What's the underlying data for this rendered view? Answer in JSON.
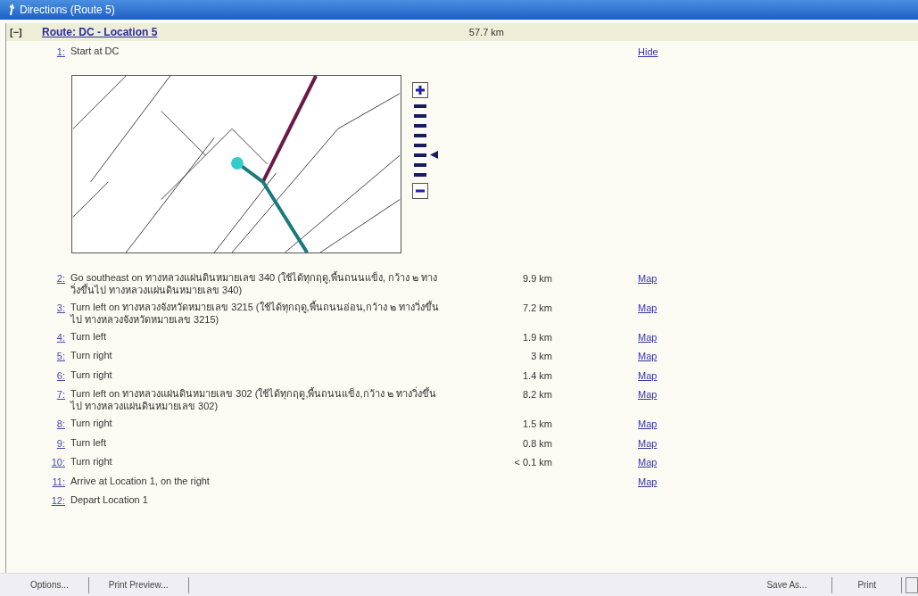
{
  "window": {
    "title": "Directions (Route 5)"
  },
  "route": {
    "toggle": "[−]",
    "expanded": true,
    "title": "Route: DC - Location 5",
    "distance": "57.7 km"
  },
  "steps": [
    {
      "number": "1:",
      "text": "Start at DC",
      "link": "Hide",
      "kind": "map",
      "zoom": {
        "level": 0.35
      }
    },
    {
      "number": "2:",
      "text": "Go southeast on ทางหลวงแผ่นดินหมายเลข 340 (ใช้ได้ทุกฤดู,พื้นถนนแข็ง, กว้าง ๒ ทางวิ่งขึ้นไป ทางหลวงแผ่นดินหมายเลข 340)",
      "distance": "9.9 km",
      "link": "Map",
      "kind": "step"
    },
    {
      "number": "3:",
      "text": "Turn left on ทางหลวงจังหวัดหมายเลข 3215 (ใช้ได้ทุกฤดู,พื้นถนนอ่อน,กว้าง ๒ ทางวิ่งขึ้นไป ทางหลวงจังหวัดหมายเลข 3215)",
      "distance": "7.2 km",
      "link": "Map",
      "kind": "step"
    },
    {
      "number": "4:",
      "text": "Turn left",
      "distance": "1.9 km",
      "link": "Map",
      "kind": "step"
    },
    {
      "number": "5:",
      "text": "Turn right",
      "distance": "3 km",
      "link": "Map",
      "kind": "step"
    },
    {
      "number": "6:",
      "text": "Turn right",
      "distance": "1.4 km",
      "link": "Map",
      "kind": "step"
    },
    {
      "number": "7:",
      "text": "Turn left on ทางหลวงแผ่นดินหมายเลข 302 (ใช้ได้ทุกฤดู,พื้นถนนแข็ง,กว้าง ๒ ทางวิ่งขึ้นไป ทางหลวงแผ่นดินหมายเลข 302)",
      "distance": "8.2 km",
      "link": "Map",
      "kind": "step"
    },
    {
      "number": "8:",
      "text": "Turn right",
      "distance": "1.5 km",
      "link": "Map",
      "kind": "step"
    },
    {
      "number": "9:",
      "text": "Turn left",
      "distance": "0.8 km",
      "link": "Map",
      "kind": "step"
    },
    {
      "number": "10:",
      "text": "Turn right",
      "distance": "< 0.1 km",
      "link": "Map",
      "kind": "step"
    },
    {
      "number": "11:",
      "text": "Arrive at Location 1, on the right",
      "link": "Map",
      "kind": "step"
    },
    {
      "number": "12:",
      "text": "Depart Location 1",
      "kind": "step"
    }
  ],
  "buttons_left": [
    "Options...",
    "Print Preview..."
  ],
  "buttons_right": [
    "Save As...",
    "Print"
  ]
}
